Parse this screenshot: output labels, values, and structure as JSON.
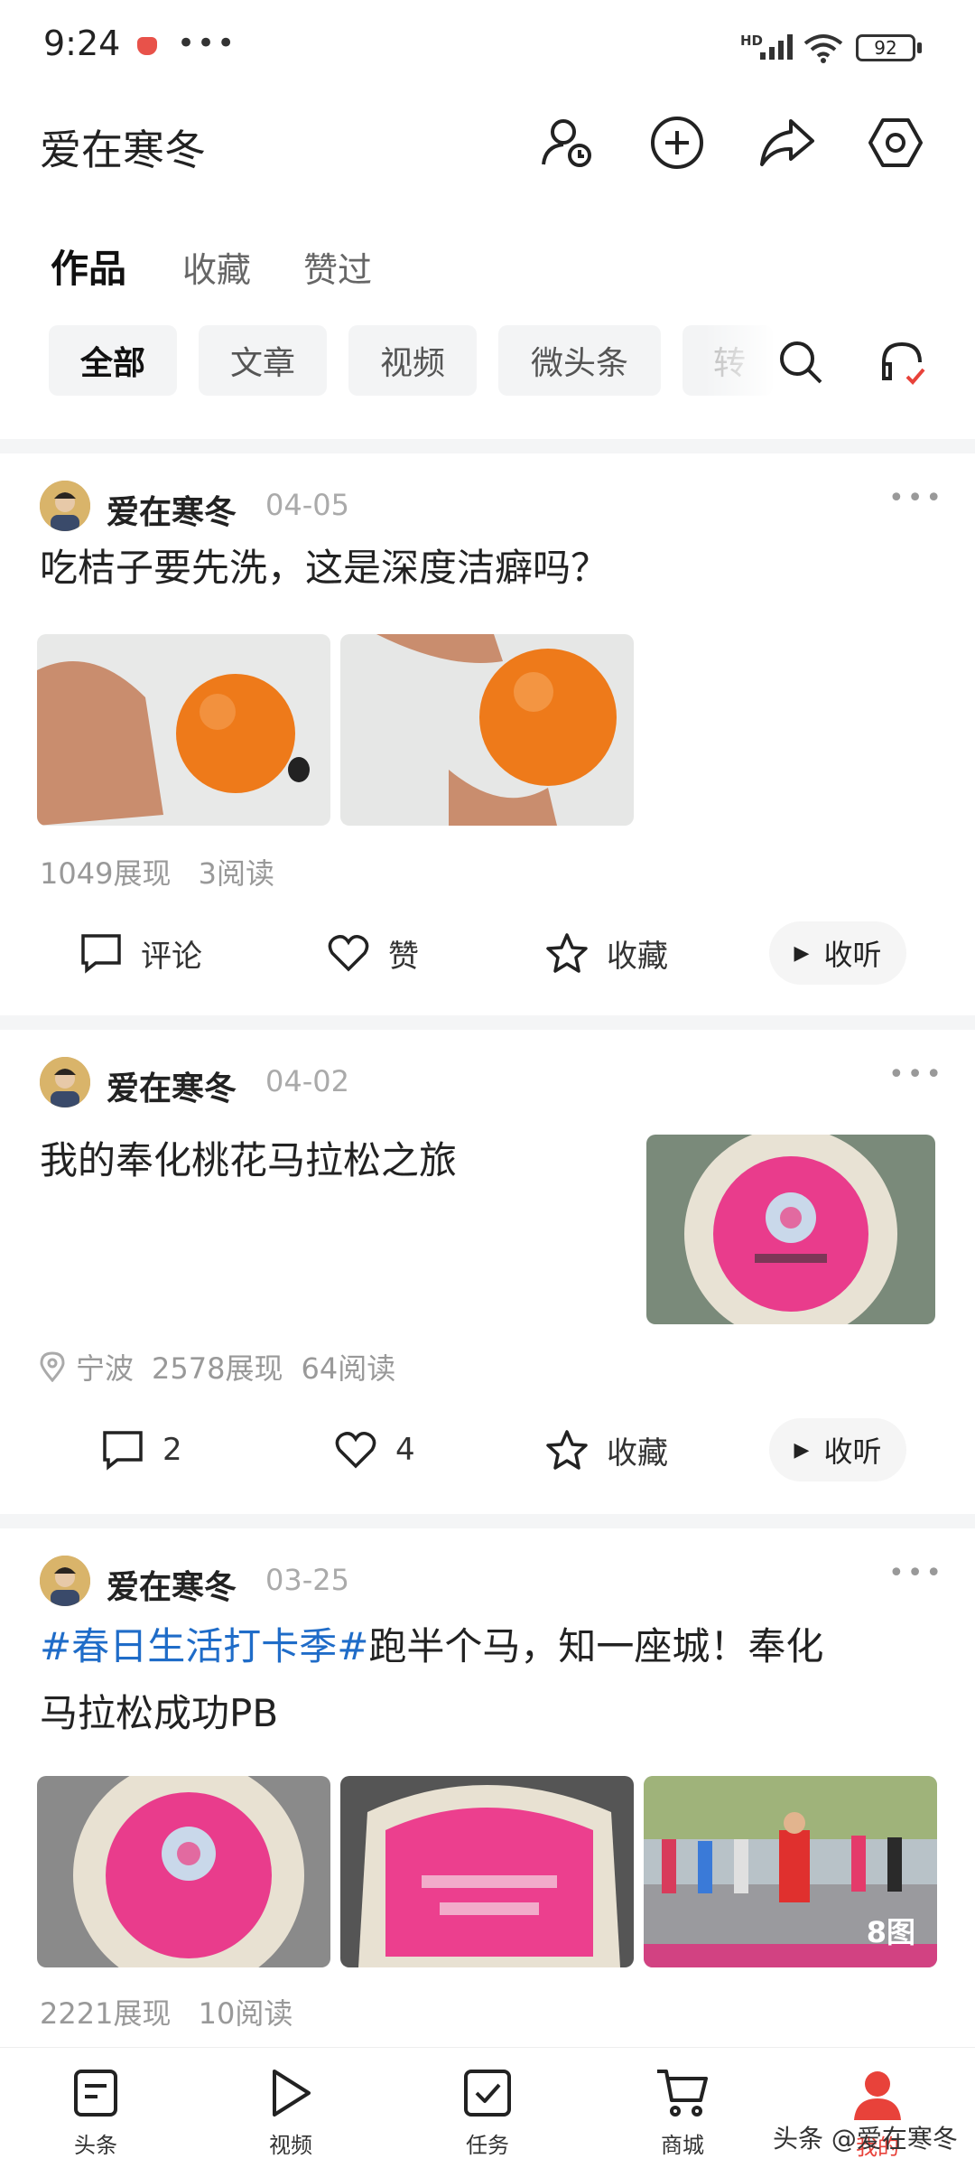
{
  "status_bar": {
    "time": "9:24",
    "more": "•••",
    "network": "HD",
    "battery": "92"
  },
  "header": {
    "title": "爱在寒冬",
    "icons": [
      "user-clock-icon",
      "plus-circle-icon",
      "share-icon",
      "settings-icon"
    ]
  },
  "tabs": [
    {
      "label": "作品",
      "active": true
    },
    {
      "label": "收藏",
      "active": false
    },
    {
      "label": "赞过",
      "active": false
    }
  ],
  "filters": [
    {
      "label": "全部",
      "active": true
    },
    {
      "label": "文章",
      "active": false
    },
    {
      "label": "视频",
      "active": false
    },
    {
      "label": "微头条",
      "active": false
    },
    {
      "label": "转",
      "active": false
    }
  ],
  "posts": [
    {
      "author": "爱在寒冬",
      "date": "04-05",
      "title": "吃桔子要先洗，这是深度洁癖吗？",
      "stats": {
        "views": "1049展现",
        "reads": "3阅读"
      },
      "actions": {
        "comment": "评论",
        "like": "赞",
        "favorite": "收藏",
        "listen": "收听"
      }
    },
    {
      "author": "爱在寒冬",
      "date": "04-02",
      "title": "我的奉化桃花马拉松之旅",
      "location": "宁波",
      "stats": {
        "views": "2578展现",
        "reads": "64阅读"
      },
      "actions": {
        "comment": "2",
        "like": "4",
        "favorite": "收藏",
        "listen": "收听"
      }
    },
    {
      "author": "爱在寒冬",
      "date": "03-25",
      "hashtag": "#春日生活打卡季#",
      "title_rest": "跑半个马，知一座城！奉化",
      "title_line2": "马拉松成功PB",
      "image_count": "8图",
      "stats": {
        "views": "2221展现",
        "reads": "10阅读"
      }
    }
  ],
  "bottom_nav": [
    {
      "label": "头条",
      "icon": "document-icon"
    },
    {
      "label": "视频",
      "icon": "play-icon"
    },
    {
      "label": "任务",
      "icon": "task-check-icon"
    },
    {
      "label": "商城",
      "icon": "cart-icon"
    },
    {
      "label": "我的",
      "icon": "profile-icon"
    }
  ],
  "watermark": "头条 @爱在寒冬",
  "colors": {
    "accent": "#e8423a",
    "hashtag": "#1f6cc8"
  }
}
